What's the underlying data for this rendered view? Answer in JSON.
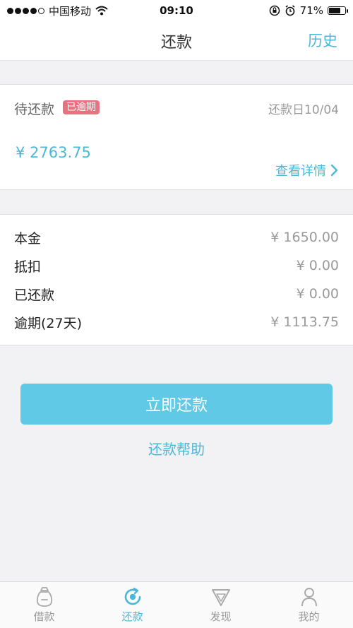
{
  "status_bar": {
    "carrier": "中国移动",
    "time": "09:10",
    "battery": "71%",
    "battery_level": 0.71
  },
  "nav": {
    "title": "还款",
    "history": "历史"
  },
  "due": {
    "label": "待还款",
    "badge": "已逾期",
    "date": "还款日10/04",
    "amount": "¥ 2763.75",
    "detail_link": "查看详情"
  },
  "breakdown": [
    {
      "label": "本金",
      "value": "¥ 1650.00"
    },
    {
      "label": "抵扣",
      "value": "¥ 0.00"
    },
    {
      "label": "已还款",
      "value": "¥ 0.00"
    },
    {
      "label": "逾期(27天)",
      "value": "¥ 1113.75"
    }
  ],
  "actions": {
    "repay": "立即还款",
    "help": "还款帮助"
  },
  "tabs": [
    {
      "label": "借款",
      "icon": "bag-icon",
      "active": false
    },
    {
      "label": "还款",
      "icon": "repay-icon",
      "active": true
    },
    {
      "label": "发现",
      "icon": "diamond-icon",
      "active": false
    },
    {
      "label": "我的",
      "icon": "person-icon",
      "active": false
    }
  ],
  "colors": {
    "accent": "#4ab8d8",
    "button": "#60c9e5",
    "badge": "#e8727f",
    "inactive_tab": "#999999"
  }
}
